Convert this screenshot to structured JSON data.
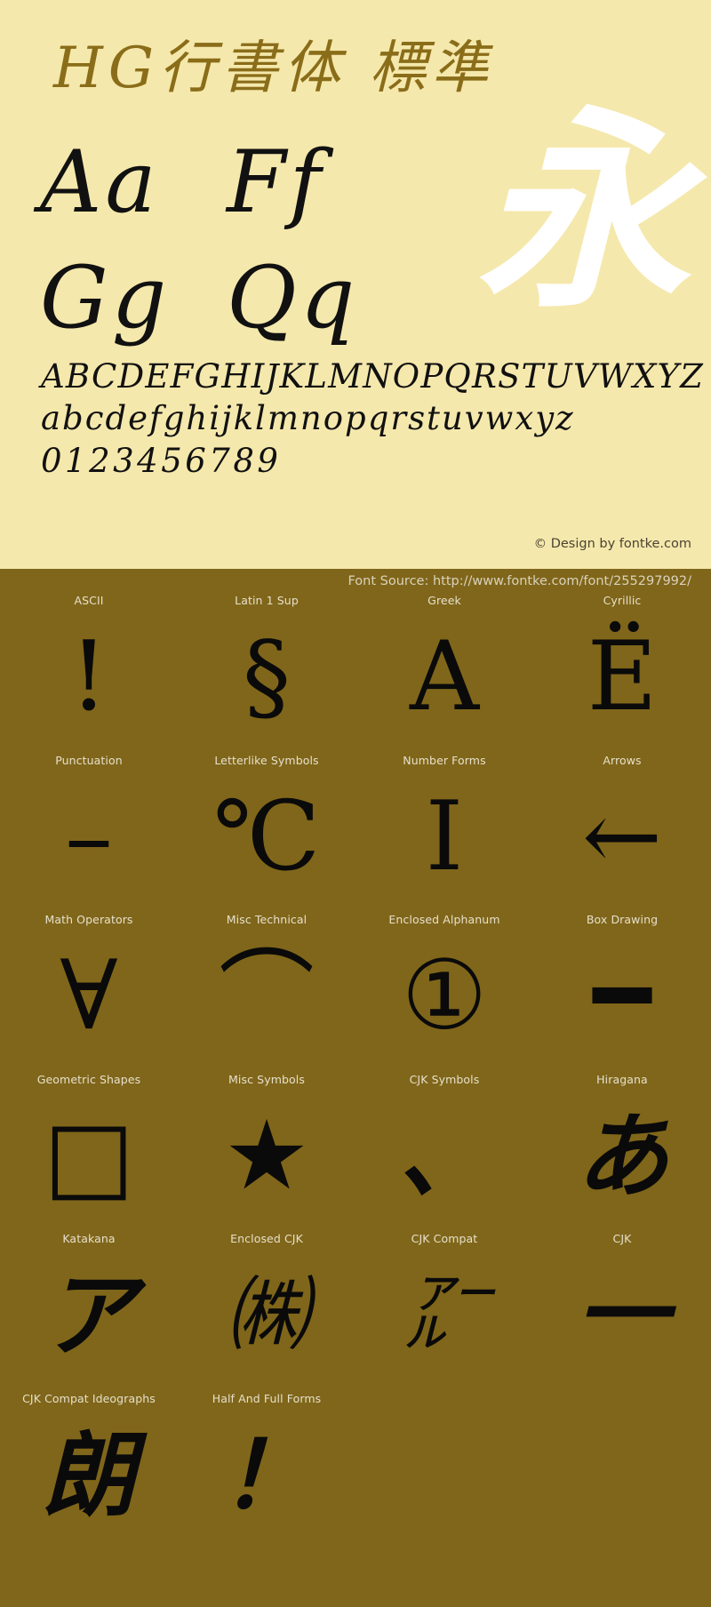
{
  "specimen": {
    "title": "HG行書体 標準",
    "showcase_kanji": "永",
    "letter_pairs": [
      [
        "Aa",
        "Ff"
      ],
      [
        "Gg",
        "Qq"
      ]
    ],
    "uppercase_alphabet": "ABCDEFGHIJKLMNOPQRSTUVWXYZ",
    "lowercase_alphabet": "abcdefghijklmnopqrstuvwxyz",
    "digits": "0123456789",
    "credit": "© Design by fontke.com",
    "credit_symbol": "©",
    "credit_text": "Design by fontke.com",
    "colors": {
      "specimen_background": "#f5e8ac",
      "title_color": "#8a6d19",
      "glyph_color": "#111111",
      "showcase_color": "#ffffff",
      "blocks_background": "#80661a",
      "block_label_color": "#e6e0cc"
    }
  },
  "blocks": {
    "source_label": "Font Source: http://www.fontke.com/font/255297992/",
    "rows": [
      [
        {
          "label": "ASCII",
          "glyph": "!",
          "style": "thin"
        },
        {
          "label": "Latin 1 Sup",
          "glyph": "§",
          "style": "thin"
        },
        {
          "label": "Greek",
          "glyph": "Α",
          "style": "thin"
        },
        {
          "label": "Cyrillic",
          "glyph": "Ё",
          "style": "thin"
        }
      ],
      [
        {
          "label": "Punctuation",
          "glyph": "–",
          "style": "thin"
        },
        {
          "label": "Letterlike Symbols",
          "glyph": "℃",
          "style": "thin"
        },
        {
          "label": "Number Forms",
          "glyph": "Ⅰ",
          "style": "thin"
        },
        {
          "label": "Arrows",
          "glyph": "←",
          "style": "thin"
        }
      ],
      [
        {
          "label": "Math Operators",
          "glyph": "∀",
          "style": "thin"
        },
        {
          "label": "Misc Technical",
          "glyph": "⌒",
          "style": "thin"
        },
        {
          "label": "Enclosed Alphanum",
          "glyph": "①",
          "style": "thin"
        },
        {
          "label": "Box Drawing",
          "glyph": "━",
          "style": "thin"
        }
      ],
      [
        {
          "label": "Geometric Shapes",
          "glyph": "□",
          "style": "thin"
        },
        {
          "label": "Misc Symbols",
          "glyph": "★",
          "style": "thin"
        },
        {
          "label": "CJK Symbols",
          "glyph": "、",
          "style": "cjk"
        },
        {
          "label": "Hiragana",
          "glyph": "あ",
          "style": "cjk"
        }
      ],
      [
        {
          "label": "Katakana",
          "glyph": "ア",
          "style": "cjk"
        },
        {
          "label": "Enclosed CJK",
          "glyph": "㈱",
          "style": "wide"
        },
        {
          "label": "CJK Compat",
          "glyph": "㌃",
          "style": "wide"
        },
        {
          "label": "CJK",
          "glyph": "一",
          "style": "cjk"
        }
      ],
      [
        {
          "label": "CJK Compat Ideographs",
          "glyph": "朗",
          "style": "cjk"
        },
        {
          "label": "Half And Full Forms",
          "glyph": "！",
          "style": "cjk"
        },
        {
          "label": "",
          "glyph": "",
          "style": "thin"
        },
        {
          "label": "",
          "glyph": "",
          "style": "thin"
        }
      ]
    ]
  }
}
